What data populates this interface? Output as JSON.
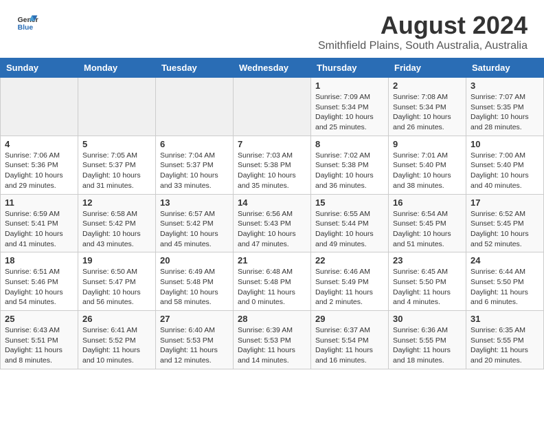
{
  "header": {
    "logo_line1": "General",
    "logo_line2": "Blue",
    "main_title": "August 2024",
    "subtitle": "Smithfield Plains, South Australia, Australia"
  },
  "weekdays": [
    "Sunday",
    "Monday",
    "Tuesday",
    "Wednesday",
    "Thursday",
    "Friday",
    "Saturday"
  ],
  "weeks": [
    [
      {
        "day": "",
        "info": ""
      },
      {
        "day": "",
        "info": ""
      },
      {
        "day": "",
        "info": ""
      },
      {
        "day": "",
        "info": ""
      },
      {
        "day": "1",
        "info": "Sunrise: 7:09 AM\nSunset: 5:34 PM\nDaylight: 10 hours\nand 25 minutes."
      },
      {
        "day": "2",
        "info": "Sunrise: 7:08 AM\nSunset: 5:34 PM\nDaylight: 10 hours\nand 26 minutes."
      },
      {
        "day": "3",
        "info": "Sunrise: 7:07 AM\nSunset: 5:35 PM\nDaylight: 10 hours\nand 28 minutes."
      }
    ],
    [
      {
        "day": "4",
        "info": "Sunrise: 7:06 AM\nSunset: 5:36 PM\nDaylight: 10 hours\nand 29 minutes."
      },
      {
        "day": "5",
        "info": "Sunrise: 7:05 AM\nSunset: 5:37 PM\nDaylight: 10 hours\nand 31 minutes."
      },
      {
        "day": "6",
        "info": "Sunrise: 7:04 AM\nSunset: 5:37 PM\nDaylight: 10 hours\nand 33 minutes."
      },
      {
        "day": "7",
        "info": "Sunrise: 7:03 AM\nSunset: 5:38 PM\nDaylight: 10 hours\nand 35 minutes."
      },
      {
        "day": "8",
        "info": "Sunrise: 7:02 AM\nSunset: 5:38 PM\nDaylight: 10 hours\nand 36 minutes."
      },
      {
        "day": "9",
        "info": "Sunrise: 7:01 AM\nSunset: 5:40 PM\nDaylight: 10 hours\nand 38 minutes."
      },
      {
        "day": "10",
        "info": "Sunrise: 7:00 AM\nSunset: 5:40 PM\nDaylight: 10 hours\nand 40 minutes."
      }
    ],
    [
      {
        "day": "11",
        "info": "Sunrise: 6:59 AM\nSunset: 5:41 PM\nDaylight: 10 hours\nand 41 minutes."
      },
      {
        "day": "12",
        "info": "Sunrise: 6:58 AM\nSunset: 5:42 PM\nDaylight: 10 hours\nand 43 minutes."
      },
      {
        "day": "13",
        "info": "Sunrise: 6:57 AM\nSunset: 5:42 PM\nDaylight: 10 hours\nand 45 minutes."
      },
      {
        "day": "14",
        "info": "Sunrise: 6:56 AM\nSunset: 5:43 PM\nDaylight: 10 hours\nand 47 minutes."
      },
      {
        "day": "15",
        "info": "Sunrise: 6:55 AM\nSunset: 5:44 PM\nDaylight: 10 hours\nand 49 minutes."
      },
      {
        "day": "16",
        "info": "Sunrise: 6:54 AM\nSunset: 5:45 PM\nDaylight: 10 hours\nand 51 minutes."
      },
      {
        "day": "17",
        "info": "Sunrise: 6:52 AM\nSunset: 5:45 PM\nDaylight: 10 hours\nand 52 minutes."
      }
    ],
    [
      {
        "day": "18",
        "info": "Sunrise: 6:51 AM\nSunset: 5:46 PM\nDaylight: 10 hours\nand 54 minutes."
      },
      {
        "day": "19",
        "info": "Sunrise: 6:50 AM\nSunset: 5:47 PM\nDaylight: 10 hours\nand 56 minutes."
      },
      {
        "day": "20",
        "info": "Sunrise: 6:49 AM\nSunset: 5:48 PM\nDaylight: 10 hours\nand 58 minutes."
      },
      {
        "day": "21",
        "info": "Sunrise: 6:48 AM\nSunset: 5:48 PM\nDaylight: 11 hours\nand 0 minutes."
      },
      {
        "day": "22",
        "info": "Sunrise: 6:46 AM\nSunset: 5:49 PM\nDaylight: 11 hours\nand 2 minutes."
      },
      {
        "day": "23",
        "info": "Sunrise: 6:45 AM\nSunset: 5:50 PM\nDaylight: 11 hours\nand 4 minutes."
      },
      {
        "day": "24",
        "info": "Sunrise: 6:44 AM\nSunset: 5:50 PM\nDaylight: 11 hours\nand 6 minutes."
      }
    ],
    [
      {
        "day": "25",
        "info": "Sunrise: 6:43 AM\nSunset: 5:51 PM\nDaylight: 11 hours\nand 8 minutes."
      },
      {
        "day": "26",
        "info": "Sunrise: 6:41 AM\nSunset: 5:52 PM\nDaylight: 11 hours\nand 10 minutes."
      },
      {
        "day": "27",
        "info": "Sunrise: 6:40 AM\nSunset: 5:53 PM\nDaylight: 11 hours\nand 12 minutes."
      },
      {
        "day": "28",
        "info": "Sunrise: 6:39 AM\nSunset: 5:53 PM\nDaylight: 11 hours\nand 14 minutes."
      },
      {
        "day": "29",
        "info": "Sunrise: 6:37 AM\nSunset: 5:54 PM\nDaylight: 11 hours\nand 16 minutes."
      },
      {
        "day": "30",
        "info": "Sunrise: 6:36 AM\nSunset: 5:55 PM\nDaylight: 11 hours\nand 18 minutes."
      },
      {
        "day": "31",
        "info": "Sunrise: 6:35 AM\nSunset: 5:55 PM\nDaylight: 11 hours\nand 20 minutes."
      }
    ]
  ]
}
